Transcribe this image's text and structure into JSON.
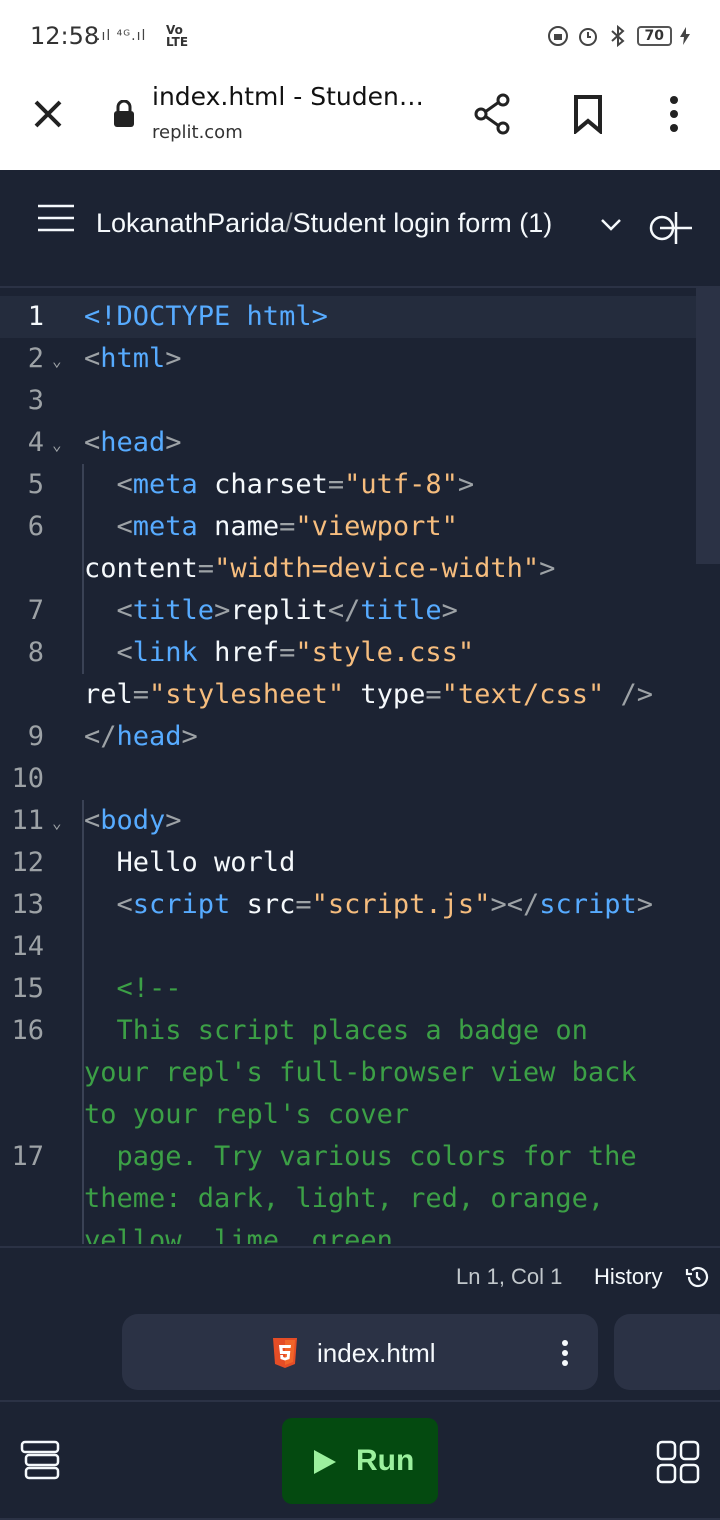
{
  "status_bar": {
    "time": "12:58",
    "signal": ".ıl ⁴ᴳ.ıl",
    "volte_top": "Vo",
    "volte_bottom": "LTE",
    "battery": "70"
  },
  "browser": {
    "page_title": "index.html - Student...",
    "domain": "replit.com"
  },
  "app_header": {
    "owner": "LokanathParida",
    "separator": "/",
    "repl_name": "Student login form (1)"
  },
  "editor": {
    "line_numbers": [
      "1",
      "2",
      "3",
      "4",
      "5",
      "6",
      "",
      "7",
      "8",
      "",
      "9",
      "10",
      "11",
      "12",
      "13",
      "14",
      "15",
      "16",
      "",
      "",
      "17",
      "",
      ""
    ],
    "code_lines": [
      [
        {
          "t": "<!DOCTYPE html>",
          "c": "tag"
        }
      ],
      [
        {
          "t": "<",
          "c": "punct"
        },
        {
          "t": "html",
          "c": "tag"
        },
        {
          "t": ">",
          "c": "punct"
        }
      ],
      [],
      [
        {
          "t": "<",
          "c": "punct"
        },
        {
          "t": "head",
          "c": "tag"
        },
        {
          "t": ">",
          "c": "punct"
        }
      ],
      [
        {
          "t": "  <",
          "c": "punct"
        },
        {
          "t": "meta",
          "c": "tag"
        },
        {
          "t": " charset",
          "c": "attr"
        },
        {
          "t": "=",
          "c": "punct"
        },
        {
          "t": "\"utf-8\"",
          "c": "str"
        },
        {
          "t": ">",
          "c": "punct"
        }
      ],
      [
        {
          "t": "  <",
          "c": "punct"
        },
        {
          "t": "meta",
          "c": "tag"
        },
        {
          "t": " name",
          "c": "attr"
        },
        {
          "t": "=",
          "c": "punct"
        },
        {
          "t": "\"viewport\"",
          "c": "str"
        }
      ],
      [
        {
          "t": "content",
          "c": "attr"
        },
        {
          "t": "=",
          "c": "punct"
        },
        {
          "t": "\"width=device-width\"",
          "c": "str"
        },
        {
          "t": ">",
          "c": "punct"
        }
      ],
      [
        {
          "t": "  <",
          "c": "punct"
        },
        {
          "t": "title",
          "c": "tag"
        },
        {
          "t": ">",
          "c": "punct"
        },
        {
          "t": "replit",
          "c": "text"
        },
        {
          "t": "</",
          "c": "punct"
        },
        {
          "t": "title",
          "c": "tag"
        },
        {
          "t": ">",
          "c": "punct"
        }
      ],
      [
        {
          "t": "  <",
          "c": "punct"
        },
        {
          "t": "link",
          "c": "tag"
        },
        {
          "t": " href",
          "c": "attr"
        },
        {
          "t": "=",
          "c": "punct"
        },
        {
          "t": "\"style.css\"",
          "c": "str"
        }
      ],
      [
        {
          "t": "rel",
          "c": "attr"
        },
        {
          "t": "=",
          "c": "punct"
        },
        {
          "t": "\"stylesheet\"",
          "c": "str"
        },
        {
          "t": " type",
          "c": "attr"
        },
        {
          "t": "=",
          "c": "punct"
        },
        {
          "t": "\"text/css\"",
          "c": "str"
        },
        {
          "t": " />",
          "c": "punct"
        }
      ],
      [
        {
          "t": "</",
          "c": "punct"
        },
        {
          "t": "head",
          "c": "tag"
        },
        {
          "t": ">",
          "c": "punct"
        }
      ],
      [],
      [
        {
          "t": "<",
          "c": "punct"
        },
        {
          "t": "body",
          "c": "tag"
        },
        {
          "t": ">",
          "c": "punct"
        }
      ],
      [
        {
          "t": "  Hello world",
          "c": "text"
        }
      ],
      [
        {
          "t": "  <",
          "c": "punct"
        },
        {
          "t": "script",
          "c": "tag"
        },
        {
          "t": " src",
          "c": "attr"
        },
        {
          "t": "=",
          "c": "punct"
        },
        {
          "t": "\"script.js\"",
          "c": "str"
        },
        {
          "t": "></",
          "c": "punct"
        },
        {
          "t": "script",
          "c": "tag"
        },
        {
          "t": ">",
          "c": "punct"
        }
      ],
      [],
      [
        {
          "t": "  <!--",
          "c": "cmt"
        }
      ],
      [
        {
          "t": "  This script places a badge on",
          "c": "cmt"
        }
      ],
      [
        {
          "t": "your repl's full-browser view back",
          "c": "cmt"
        }
      ],
      [
        {
          "t": "to your repl's cover",
          "c": "cmt"
        }
      ],
      [
        {
          "t": "  page. Try various colors for the",
          "c": "cmt"
        }
      ],
      [
        {
          "t": "theme: dark, light, red, orange,",
          "c": "cmt"
        }
      ],
      [
        {
          "t": "yellow, lime, green,",
          "c": "cmt"
        }
      ]
    ]
  },
  "status_line": {
    "position": "Ln 1, Col 1",
    "history": "History"
  },
  "file_tab": {
    "filename": "index.html"
  },
  "bottom_bar": {
    "run_label": "Run"
  },
  "colors": {
    "background": "#1c2333",
    "tag": "#57abff",
    "string": "#f6bd7e",
    "comment": "#3ca046",
    "run_bg": "#044a10"
  }
}
